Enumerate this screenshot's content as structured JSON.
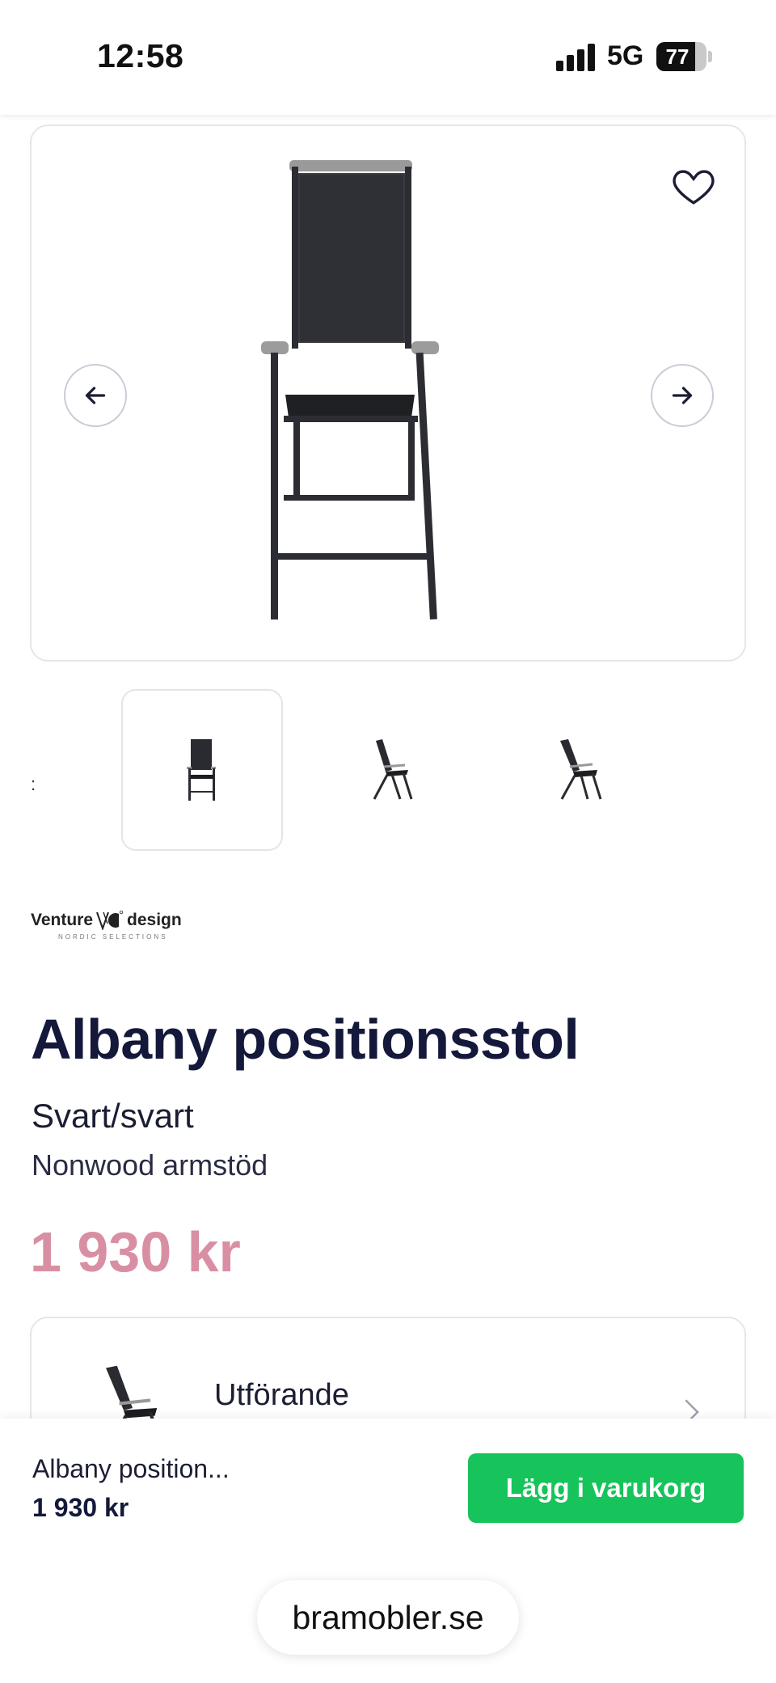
{
  "status_bar": {
    "time": "12:58",
    "network": "5G",
    "battery": "77",
    "battery_level": 0.77
  },
  "gallery": {
    "favorite_icon": "heart-icon",
    "prev_icon": "arrow-left-icon",
    "next_icon": "arrow-right-icon",
    "thumbnails": [
      {
        "view": "front",
        "selected": true
      },
      {
        "view": "side-reclined",
        "selected": false
      },
      {
        "view": "side-reclined-angle",
        "selected": false
      }
    ]
  },
  "brand": {
    "name_left": "Venture",
    "name_right": "design",
    "tagline": "NORDIC SELECTIONS"
  },
  "product": {
    "title": "Albany positionsstol",
    "variant": "Svart/svart",
    "armrest": "Nonwood armstöd",
    "price": "1 930 kr",
    "price_color": "#d98fa3"
  },
  "option": {
    "label": "Utförande",
    "chevron_icon": "chevron-right-icon"
  },
  "bottom_bar": {
    "name": "Albany position...",
    "price": "1 930 kr",
    "button_label": "Lägg i varukorg",
    "button_color": "#17c35b"
  },
  "browser": {
    "url": "bramobler.se"
  }
}
